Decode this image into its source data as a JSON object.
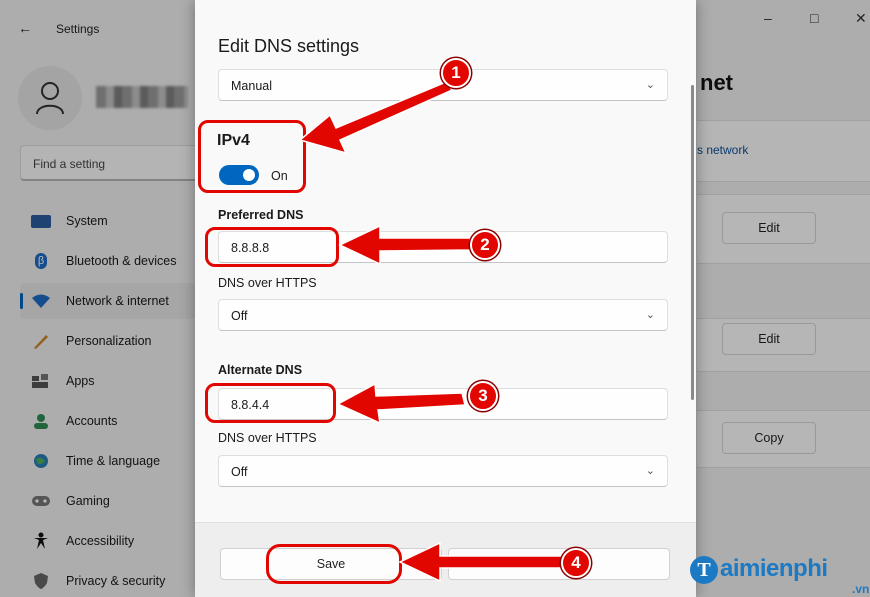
{
  "background_window": {
    "app_title": "Settings",
    "search_placeholder": "Find a setting",
    "nav_items": [
      {
        "label": "System",
        "icon": "monitor-icon"
      },
      {
        "label": "Bluetooth & devices",
        "icon": "bluetooth-icon"
      },
      {
        "label": "Network & internet",
        "icon": "wifi-icon",
        "active": true
      },
      {
        "label": "Personalization",
        "icon": "brush-icon"
      },
      {
        "label": "Apps",
        "icon": "apps-icon"
      },
      {
        "label": "Accounts",
        "icon": "person-icon"
      },
      {
        "label": "Time & language",
        "icon": "globe-icon"
      },
      {
        "label": "Gaming",
        "icon": "gamepad-icon"
      },
      {
        "label": "Accessibility",
        "icon": "accessibility-icon"
      },
      {
        "label": "Privacy & security",
        "icon": "shield-icon"
      }
    ],
    "page_title_partial": "net",
    "network_link_partial": "s network",
    "side_buttons": [
      "Edit",
      "Edit",
      "Copy"
    ]
  },
  "dialog": {
    "title": "Edit DNS settings",
    "mode_value": "Manual",
    "ipv4_heading": "IPv4",
    "ipv4_toggle_state": "On",
    "preferred_dns_label": "Preferred DNS",
    "preferred_dns_value": "8.8.8.8",
    "dns_over_https_label_1": "DNS over HTTPS",
    "dns_over_https_value_1": "Off",
    "alternate_dns_label": "Alternate DNS",
    "alternate_dns_value": "8.8.4.4",
    "dns_over_https_label_2": "DNS over HTTPS",
    "dns_over_https_value_2": "Off",
    "save_label": "Save",
    "cancel_label_partial": "Ca"
  },
  "annotations": {
    "markers": [
      "1",
      "2",
      "3",
      "4"
    ],
    "color": "#e10600"
  },
  "watermark": {
    "logo_letter": "T",
    "text": "aimienphi",
    "suffix": ".vn"
  },
  "colors": {
    "accent": "#0067c0",
    "highlight_red": "#e10600",
    "watermark_blue": "#1c79c4"
  }
}
